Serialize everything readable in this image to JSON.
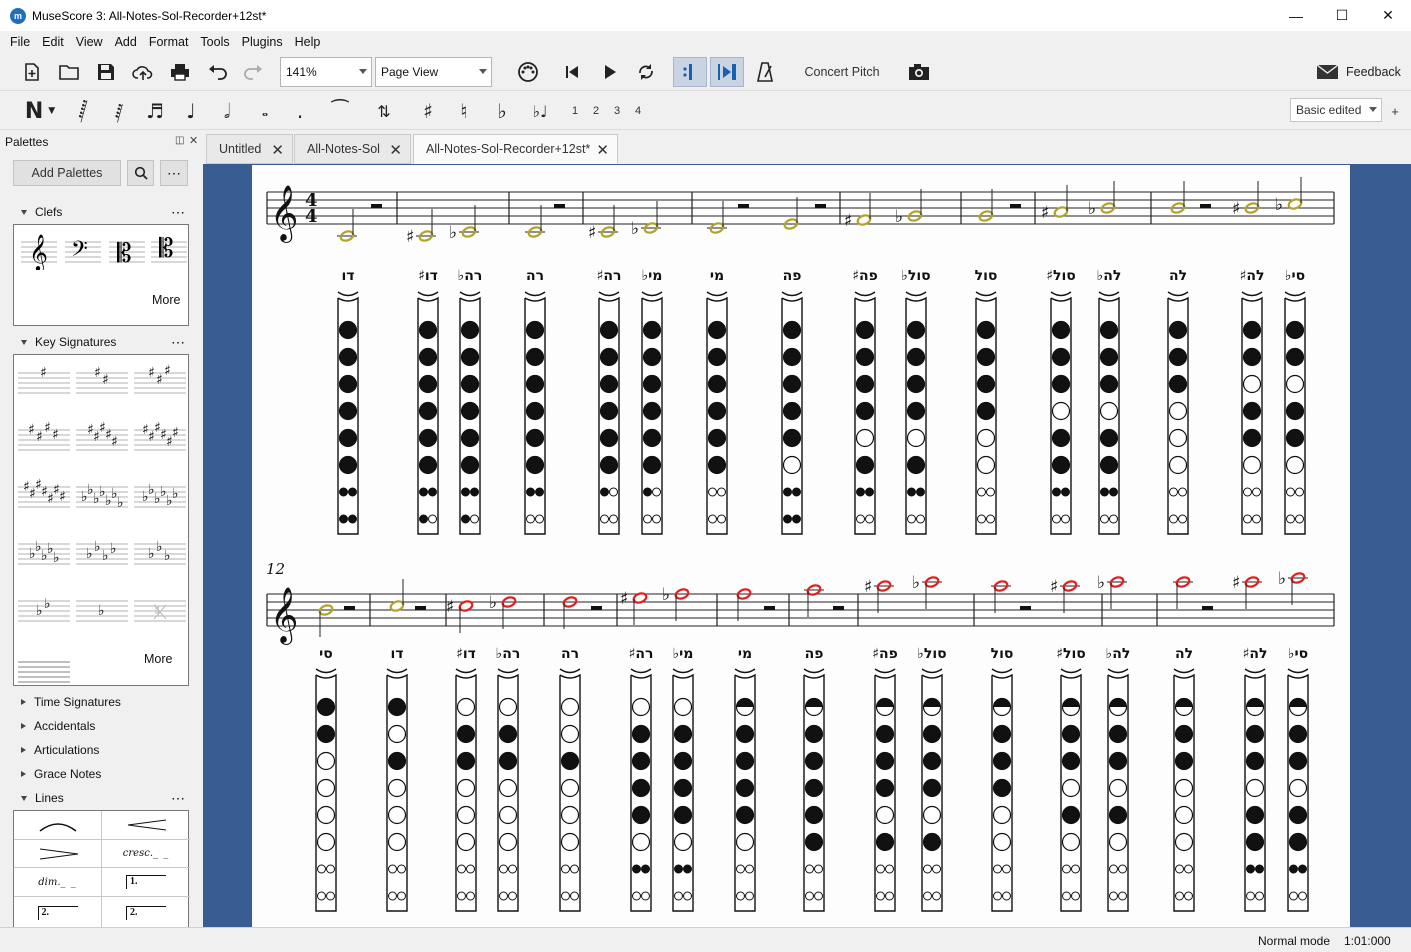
{
  "window": {
    "title": "MuseScore 3: All-Notes-Sol-Recorder+12st*",
    "app_icon": "musescore-logo-icon"
  },
  "menu": [
    "File",
    "Edit",
    "View",
    "Add",
    "Format",
    "Tools",
    "Plugins",
    "Help"
  ],
  "toolbar": {
    "zoom": "141%",
    "view_mode": "Page View",
    "concert_pitch": "Concert Pitch",
    "feedback": "Feedback"
  },
  "note_toolbar": {
    "voices": [
      "1",
      "2",
      "3",
      "4"
    ],
    "workspace": "Basic edited",
    "add_workspace": "+"
  },
  "palettes": {
    "title": "Palettes",
    "add_button": "Add Palettes",
    "sections": {
      "clefs": "Clefs",
      "key_signatures": "Key Signatures",
      "time_signatures": "Time Signatures",
      "accidentals": "Accidentals",
      "articulations": "Articulations",
      "grace_notes": "Grace Notes",
      "lines": "Lines"
    },
    "more": "More",
    "lines_cells": {
      "cresc": "cresc.",
      "dim": "dim.",
      "volta1": "1.",
      "volta2": "2."
    }
  },
  "tabs": [
    "Untitled",
    "All-Notes-Sol",
    "All-Notes-Sol-Recorder+12st*"
  ],
  "score": {
    "time_signature": [
      "4",
      "4"
    ],
    "measure_number_row2": "12",
    "row1_labels": [
      "דו",
      "דו♯",
      "רה♭",
      "רה",
      "רה♯",
      "מי♭",
      "מי",
      "פה",
      "פה♯",
      "סול♭",
      "סול",
      "סול♯",
      "לה♭",
      "לה",
      "לה♯",
      "סי♭"
    ],
    "row2_labels": [
      "סי",
      "דו",
      "דו♯",
      "רה♭",
      "רה",
      "רה♯",
      "מי♭",
      "מי",
      "פה",
      "פה♯",
      "סול♭",
      "סול",
      "סול♯",
      "לה♭",
      "לה",
      "לה♯",
      "סי♭"
    ],
    "note_colors": {
      "row1": "#b3a32a",
      "row2": "#e02020"
    },
    "fingering_legend": "F=filled, E=empty, H=half; last two entries are double holes (FF, FE, EE)",
    "row1_fingerings": [
      [
        "F",
        "F",
        "F",
        "F",
        "F",
        "F",
        "FF",
        "FF"
      ],
      [
        "F",
        "F",
        "F",
        "F",
        "F",
        "F",
        "FF",
        "FE"
      ],
      [
        "F",
        "F",
        "F",
        "F",
        "F",
        "F",
        "FF",
        "FE"
      ],
      [
        "F",
        "F",
        "F",
        "F",
        "F",
        "F",
        "FF",
        "EE"
      ],
      [
        "F",
        "F",
        "F",
        "F",
        "F",
        "F",
        "FE",
        "EE"
      ],
      [
        "F",
        "F",
        "F",
        "F",
        "F",
        "F",
        "FE",
        "EE"
      ],
      [
        "F",
        "F",
        "F",
        "F",
        "F",
        "F",
        "EE",
        "EE"
      ],
      [
        "F",
        "F",
        "F",
        "F",
        "F",
        "E",
        "FF",
        "FF"
      ],
      [
        "F",
        "F",
        "F",
        "F",
        "E",
        "F",
        "FF",
        "EE"
      ],
      [
        "F",
        "F",
        "F",
        "F",
        "E",
        "F",
        "FF",
        "EE"
      ],
      [
        "F",
        "F",
        "F",
        "F",
        "E",
        "E",
        "EE",
        "EE"
      ],
      [
        "F",
        "F",
        "F",
        "E",
        "F",
        "F",
        "FF",
        "EE"
      ],
      [
        "F",
        "F",
        "F",
        "E",
        "F",
        "F",
        "FF",
        "EE"
      ],
      [
        "F",
        "F",
        "F",
        "E",
        "E",
        "E",
        "EE",
        "EE"
      ],
      [
        "F",
        "F",
        "E",
        "F",
        "F",
        "E",
        "EE",
        "EE"
      ],
      [
        "F",
        "F",
        "E",
        "F",
        "F",
        "E",
        "EE",
        "EE"
      ]
    ],
    "row2_fingerings": [
      [
        "F",
        "F",
        "E",
        "E",
        "E",
        "E",
        "EE",
        "EE"
      ],
      [
        "F",
        "E",
        "F",
        "E",
        "E",
        "E",
        "EE",
        "EE"
      ],
      [
        "E",
        "F",
        "F",
        "E",
        "E",
        "E",
        "EE",
        "EE"
      ],
      [
        "E",
        "F",
        "F",
        "E",
        "E",
        "E",
        "EE",
        "EE"
      ],
      [
        "E",
        "E",
        "F",
        "E",
        "E",
        "E",
        "EE",
        "EE"
      ],
      [
        "E",
        "F",
        "F",
        "F",
        "F",
        "E",
        "FF",
        "EE"
      ],
      [
        "E",
        "F",
        "F",
        "F",
        "F",
        "E",
        "FF",
        "EE"
      ],
      [
        "H",
        "F",
        "F",
        "F",
        "F",
        "E",
        "EE",
        "EE"
      ],
      [
        "H",
        "F",
        "F",
        "F",
        "F",
        "F",
        "EE",
        "EE"
      ],
      [
        "H",
        "F",
        "F",
        "F",
        "E",
        "F",
        "EE",
        "EE"
      ],
      [
        "H",
        "F",
        "F",
        "F",
        "E",
        "F",
        "EE",
        "EE"
      ],
      [
        "H",
        "F",
        "F",
        "F",
        "E",
        "E",
        "EE",
        "EE"
      ],
      [
        "H",
        "F",
        "F",
        "E",
        "F",
        "E",
        "EE",
        "EE"
      ],
      [
        "H",
        "F",
        "F",
        "E",
        "F",
        "E",
        "EE",
        "EE"
      ],
      [
        "H",
        "F",
        "F",
        "E",
        "E",
        "E",
        "EE",
        "EE"
      ],
      [
        "H",
        "F",
        "F",
        "E",
        "F",
        "F",
        "FF",
        "EE"
      ],
      [
        "H",
        "F",
        "F",
        "E",
        "F",
        "F",
        "FF",
        "EE"
      ]
    ]
  },
  "status": {
    "mode": "Normal mode",
    "time": "1:01:000"
  }
}
